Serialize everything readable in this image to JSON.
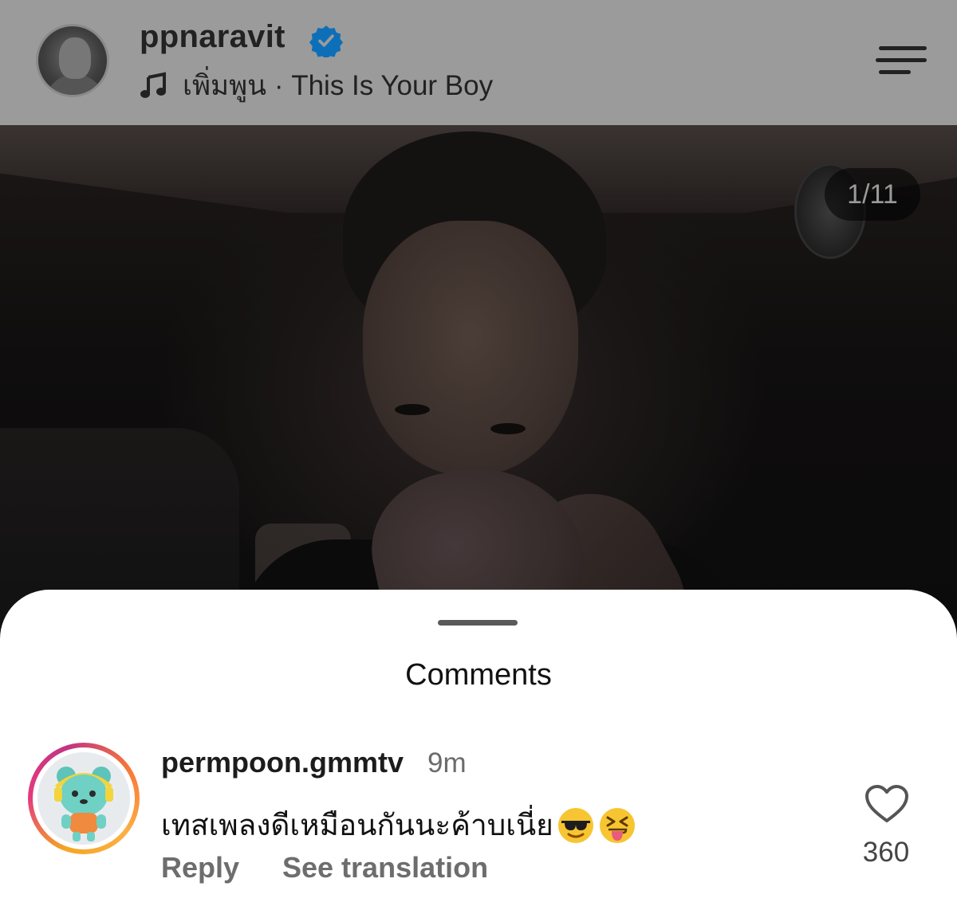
{
  "header": {
    "username": "ppnaravit",
    "verified_color": "#0095f6",
    "audio_text": "เพิ่มพูน · This Is Your Boy"
  },
  "photo": {
    "counter": "1/11"
  },
  "comments_sheet": {
    "title": "Comments",
    "comments": [
      {
        "username": "permpoon.gmmtv",
        "time": "9m",
        "text": "เทสเพลงดีเหมือนกันนะค้าบเนี่ย",
        "emojis": [
          "sunglasses-emoji",
          "squinting-tongue-emoji"
        ],
        "reply_label": "Reply",
        "translate_label": "See translation",
        "likes": "360"
      }
    ]
  }
}
